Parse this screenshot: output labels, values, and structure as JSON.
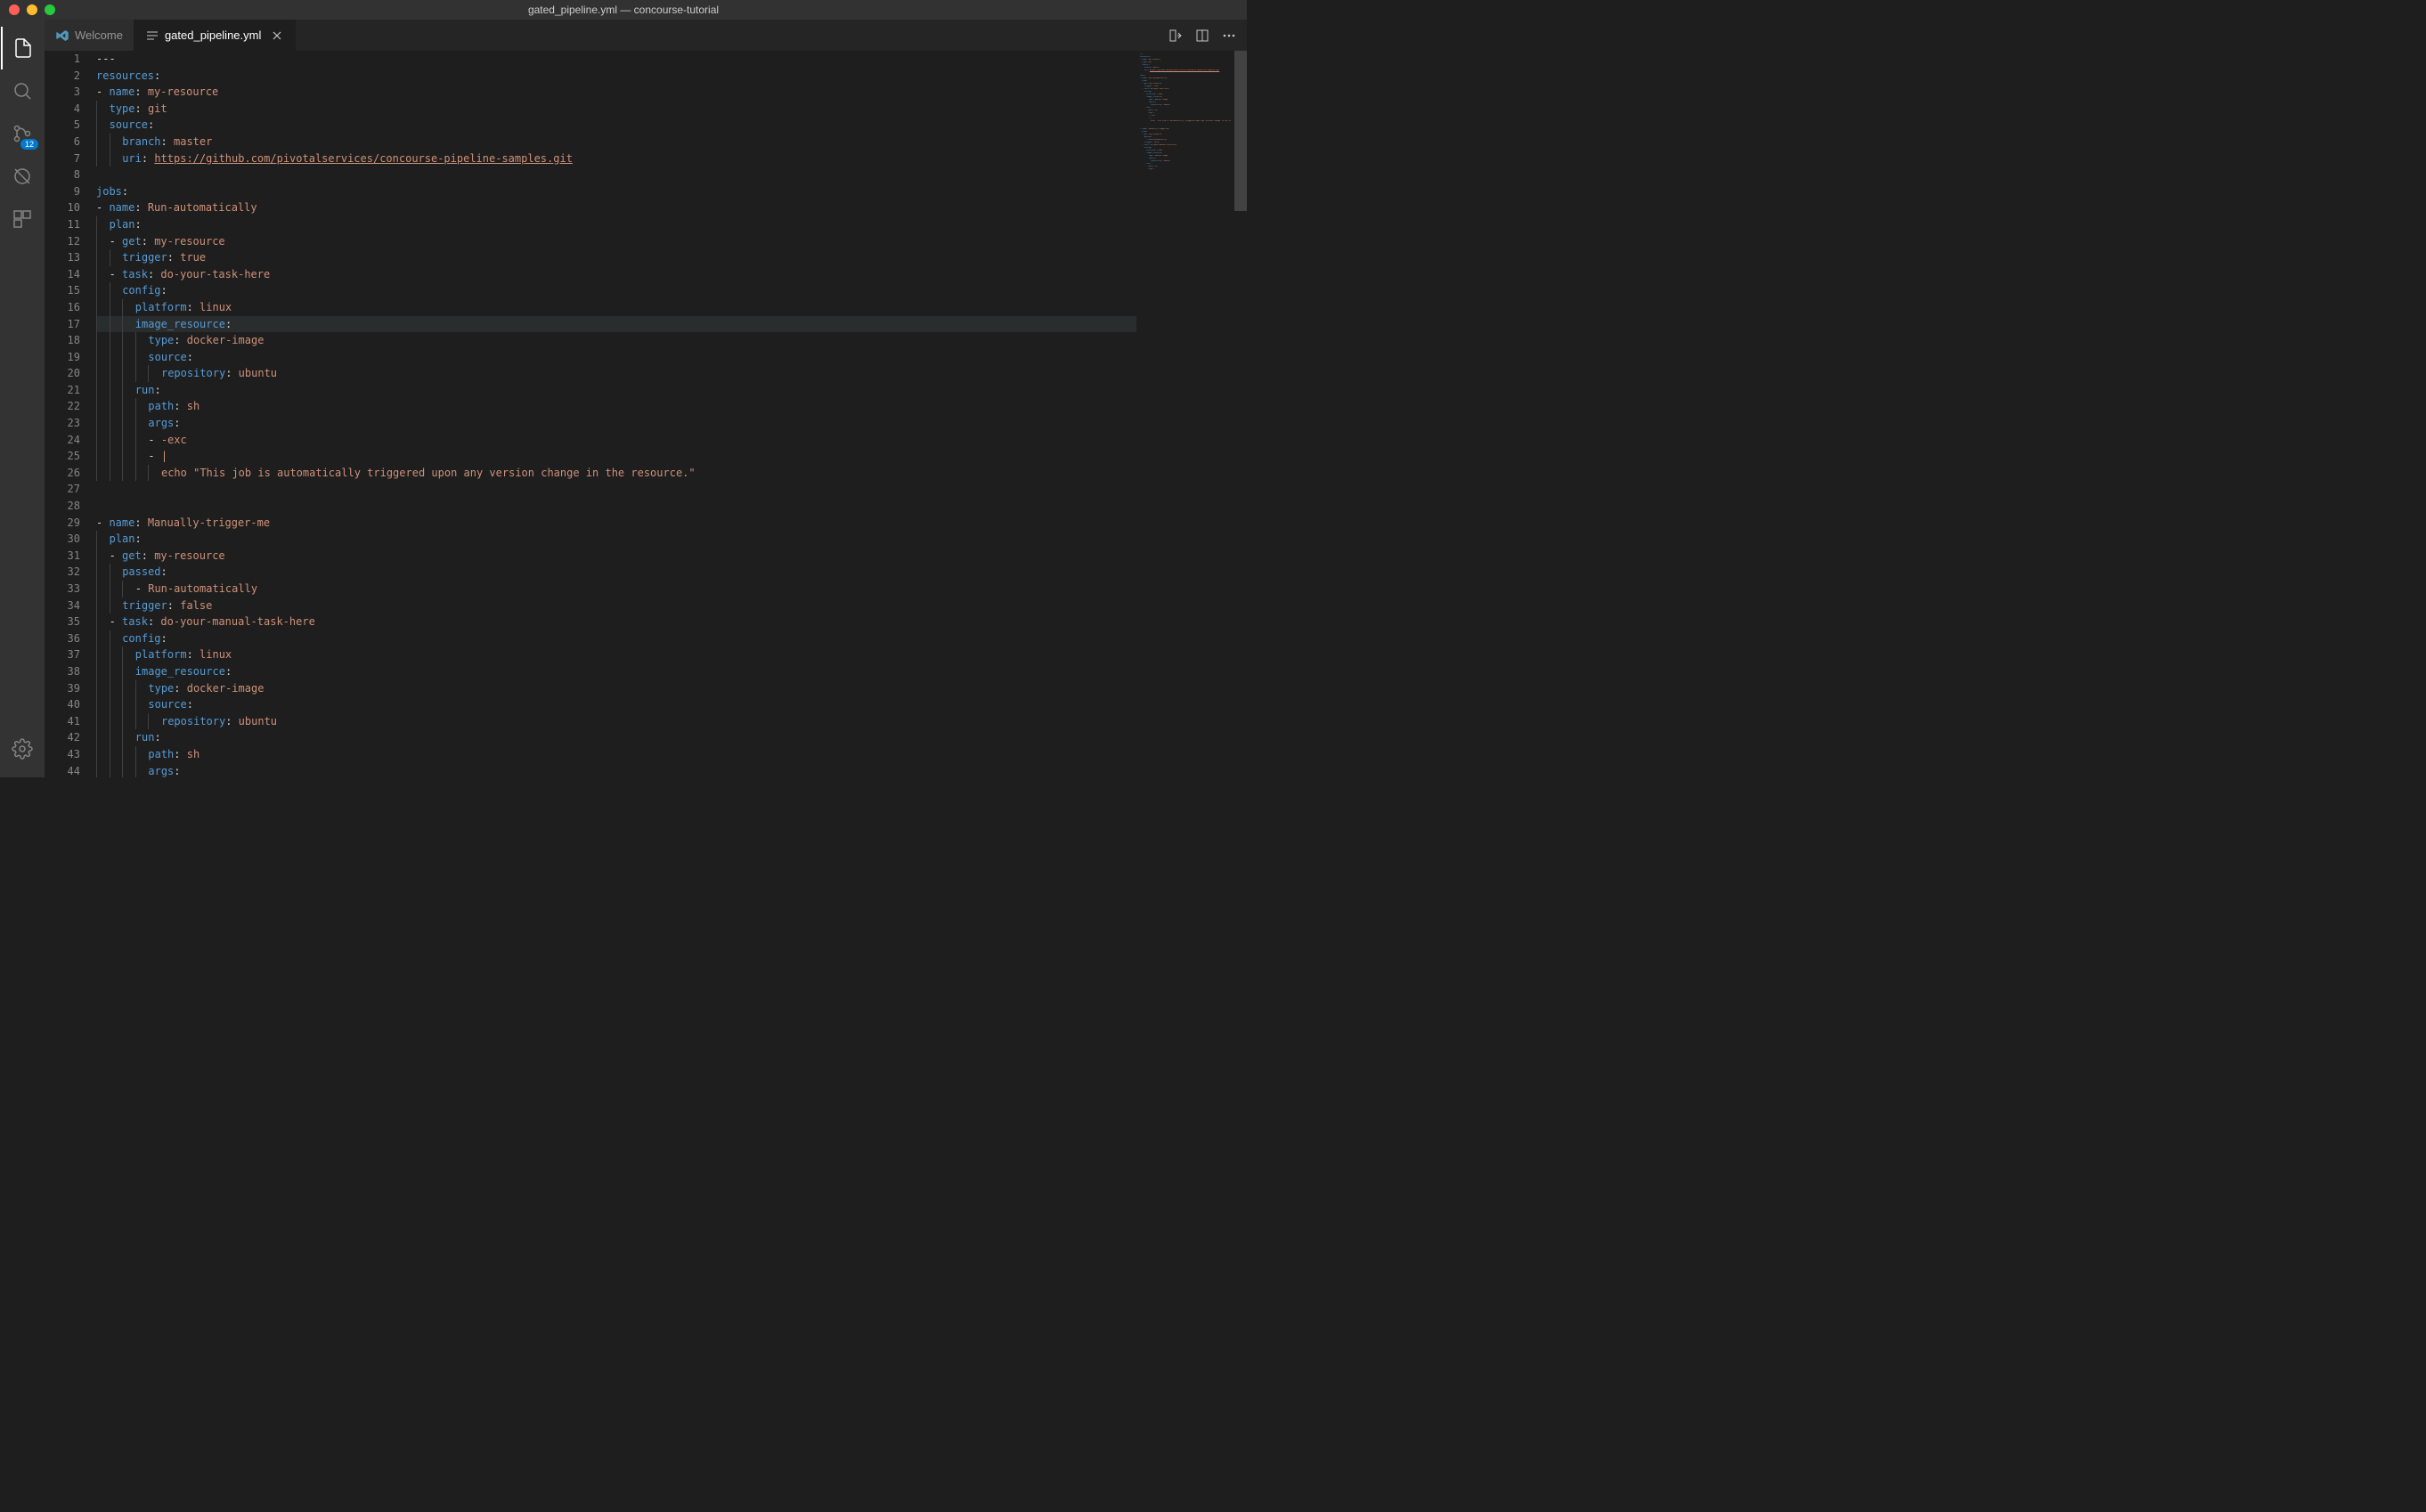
{
  "title": "gated_pipeline.yml — concourse-tutorial",
  "tabs": [
    {
      "label": "Welcome",
      "active": false,
      "icon": "vscode"
    },
    {
      "label": "gated_pipeline.yml",
      "active": true,
      "icon": "file"
    }
  ],
  "scm_badge": "12",
  "highlight_line": 17,
  "lines": [
    {
      "indent": 0,
      "text": "---",
      "tokens": [
        [
          "dash",
          "---"
        ]
      ]
    },
    {
      "indent": 0,
      "tokens": [
        [
          "key",
          "resources"
        ],
        [
          "colon",
          ":"
        ]
      ]
    },
    {
      "indent": 0,
      "tokens": [
        [
          "dash",
          "- "
        ],
        [
          "key",
          "name"
        ],
        [
          "colon",
          ": "
        ],
        [
          "val",
          "my-resource"
        ]
      ]
    },
    {
      "indent": 1,
      "tokens": [
        [
          "key",
          "type"
        ],
        [
          "colon",
          ": "
        ],
        [
          "val",
          "git"
        ]
      ]
    },
    {
      "indent": 1,
      "tokens": [
        [
          "key",
          "source"
        ],
        [
          "colon",
          ":"
        ]
      ]
    },
    {
      "indent": 2,
      "tokens": [
        [
          "key",
          "branch"
        ],
        [
          "colon",
          ": "
        ],
        [
          "val",
          "master"
        ]
      ]
    },
    {
      "indent": 2,
      "tokens": [
        [
          "key",
          "uri"
        ],
        [
          "colon",
          ": "
        ],
        [
          "link",
          "https://github.com/pivotalservices/concourse-pipeline-samples.git"
        ]
      ]
    },
    {
      "indent": 0,
      "tokens": []
    },
    {
      "indent": 0,
      "tokens": [
        [
          "key",
          "jobs"
        ],
        [
          "colon",
          ":"
        ]
      ]
    },
    {
      "indent": 0,
      "tokens": [
        [
          "dash",
          "- "
        ],
        [
          "key",
          "name"
        ],
        [
          "colon",
          ": "
        ],
        [
          "val",
          "Run-automatically"
        ]
      ]
    },
    {
      "indent": 1,
      "tokens": [
        [
          "key",
          "plan"
        ],
        [
          "colon",
          ":"
        ]
      ]
    },
    {
      "indent": 1,
      "tokens": [
        [
          "dash",
          "- "
        ],
        [
          "key",
          "get"
        ],
        [
          "colon",
          ": "
        ],
        [
          "val",
          "my-resource"
        ]
      ]
    },
    {
      "indent": 2,
      "tokens": [
        [
          "key",
          "trigger"
        ],
        [
          "colon",
          ": "
        ],
        [
          "val",
          "true"
        ]
      ]
    },
    {
      "indent": 1,
      "tokens": [
        [
          "dash",
          "- "
        ],
        [
          "key",
          "task"
        ],
        [
          "colon",
          ": "
        ],
        [
          "val",
          "do-your-task-here"
        ]
      ]
    },
    {
      "indent": 2,
      "tokens": [
        [
          "key",
          "config"
        ],
        [
          "colon",
          ":"
        ]
      ]
    },
    {
      "indent": 3,
      "tokens": [
        [
          "key",
          "platform"
        ],
        [
          "colon",
          ": "
        ],
        [
          "val",
          "linux"
        ]
      ]
    },
    {
      "indent": 3,
      "tokens": [
        [
          "key",
          "image_resource"
        ],
        [
          "colon",
          ":"
        ]
      ]
    },
    {
      "indent": 4,
      "tokens": [
        [
          "key",
          "type"
        ],
        [
          "colon",
          ": "
        ],
        [
          "val",
          "docker-image"
        ]
      ]
    },
    {
      "indent": 4,
      "tokens": [
        [
          "key",
          "source"
        ],
        [
          "colon",
          ":"
        ]
      ]
    },
    {
      "indent": 5,
      "tokens": [
        [
          "key",
          "repository"
        ],
        [
          "colon",
          ": "
        ],
        [
          "val",
          "ubuntu"
        ]
      ]
    },
    {
      "indent": 3,
      "tokens": [
        [
          "key",
          "run"
        ],
        [
          "colon",
          ":"
        ]
      ]
    },
    {
      "indent": 4,
      "tokens": [
        [
          "key",
          "path"
        ],
        [
          "colon",
          ": "
        ],
        [
          "val",
          "sh"
        ]
      ]
    },
    {
      "indent": 4,
      "tokens": [
        [
          "key",
          "args"
        ],
        [
          "colon",
          ":"
        ]
      ]
    },
    {
      "indent": 4,
      "tokens": [
        [
          "dash",
          "- "
        ],
        [
          "val",
          "-exc"
        ]
      ]
    },
    {
      "indent": 4,
      "tokens": [
        [
          "dash",
          "- "
        ],
        [
          "val",
          "|"
        ]
      ]
    },
    {
      "indent": 5,
      "tokens": [
        [
          "val",
          "echo \"This job is automatically triggered upon any version change in the resource.\""
        ]
      ]
    },
    {
      "indent": 0,
      "tokens": []
    },
    {
      "indent": 0,
      "tokens": []
    },
    {
      "indent": 0,
      "tokens": [
        [
          "dash",
          "- "
        ],
        [
          "key",
          "name"
        ],
        [
          "colon",
          ": "
        ],
        [
          "val",
          "Manually-trigger-me"
        ]
      ]
    },
    {
      "indent": 1,
      "tokens": [
        [
          "key",
          "plan"
        ],
        [
          "colon",
          ":"
        ]
      ]
    },
    {
      "indent": 1,
      "tokens": [
        [
          "dash",
          "- "
        ],
        [
          "key",
          "get"
        ],
        [
          "colon",
          ": "
        ],
        [
          "val",
          "my-resource"
        ]
      ]
    },
    {
      "indent": 2,
      "tokens": [
        [
          "key",
          "passed"
        ],
        [
          "colon",
          ":"
        ]
      ]
    },
    {
      "indent": 3,
      "tokens": [
        [
          "dash",
          "- "
        ],
        [
          "val",
          "Run-automatically"
        ]
      ]
    },
    {
      "indent": 2,
      "tokens": [
        [
          "key",
          "trigger"
        ],
        [
          "colon",
          ": "
        ],
        [
          "val",
          "false"
        ]
      ]
    },
    {
      "indent": 1,
      "tokens": [
        [
          "dash",
          "- "
        ],
        [
          "key",
          "task"
        ],
        [
          "colon",
          ": "
        ],
        [
          "val",
          "do-your-manual-task-here"
        ]
      ]
    },
    {
      "indent": 2,
      "tokens": [
        [
          "key",
          "config"
        ],
        [
          "colon",
          ":"
        ]
      ]
    },
    {
      "indent": 3,
      "tokens": [
        [
          "key",
          "platform"
        ],
        [
          "colon",
          ": "
        ],
        [
          "val",
          "linux"
        ]
      ]
    },
    {
      "indent": 3,
      "tokens": [
        [
          "key",
          "image_resource"
        ],
        [
          "colon",
          ":"
        ]
      ]
    },
    {
      "indent": 4,
      "tokens": [
        [
          "key",
          "type"
        ],
        [
          "colon",
          ": "
        ],
        [
          "val",
          "docker-image"
        ]
      ]
    },
    {
      "indent": 4,
      "tokens": [
        [
          "key",
          "source"
        ],
        [
          "colon",
          ":"
        ]
      ]
    },
    {
      "indent": 5,
      "tokens": [
        [
          "key",
          "repository"
        ],
        [
          "colon",
          ": "
        ],
        [
          "val",
          "ubuntu"
        ]
      ]
    },
    {
      "indent": 3,
      "tokens": [
        [
          "key",
          "run"
        ],
        [
          "colon",
          ":"
        ]
      ]
    },
    {
      "indent": 4,
      "tokens": [
        [
          "key",
          "path"
        ],
        [
          "colon",
          ": "
        ],
        [
          "val",
          "sh"
        ]
      ]
    },
    {
      "indent": 4,
      "tokens": [
        [
          "key",
          "args"
        ],
        [
          "colon",
          ":"
        ]
      ]
    }
  ]
}
